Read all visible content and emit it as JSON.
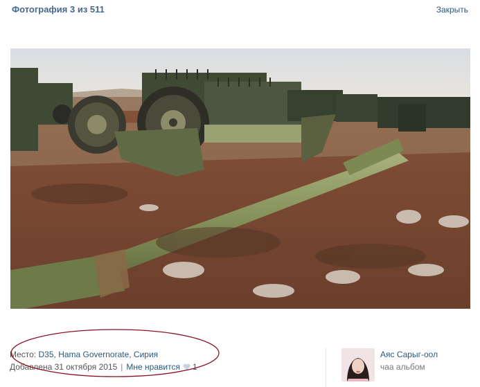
{
  "header": {
    "title": "Фотография 3 из 511",
    "close_label": "Закрыть"
  },
  "photo": {
    "description": "Abandoned D-30 howitzer with wheels and barrel lying on rocky red soil, trucks parked in background"
  },
  "meta": {
    "place_prefix": "Место: ",
    "place_link": "D35, Hama Governorate, Сирия",
    "added_text": "Добавлена 31 октября 2015",
    "separator": "|",
    "like_label": "Мне нравится",
    "like_count": "1"
  },
  "owner": {
    "name": "Аяс Сарыг-оол",
    "album": "чаа альбом"
  },
  "colors": {
    "link": "#2b587a",
    "title": "#45688e",
    "annotation": "#8a1020"
  }
}
